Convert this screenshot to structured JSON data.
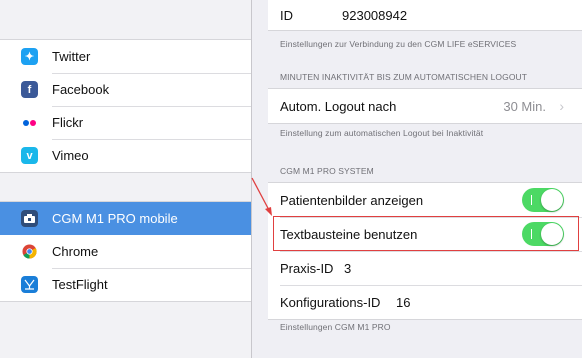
{
  "sidebar": {
    "items": [
      {
        "label": "Twitter",
        "icon": "twitter-icon",
        "color": "#1da1f2",
        "glyph": "t"
      },
      {
        "label": "Facebook",
        "icon": "facebook-icon",
        "color": "#3b5998",
        "glyph": "f"
      },
      {
        "label": "Flickr",
        "icon": "flickr-icon",
        "color": "#ffffff",
        "glyph": ""
      },
      {
        "label": "Vimeo",
        "icon": "vimeo-icon",
        "color": "#1ab7ea",
        "glyph": "v"
      }
    ],
    "apps": [
      {
        "label": "CGM M1 PRO mobile",
        "icon": "cgm-app-icon",
        "selected": true
      },
      {
        "label": "Chrome",
        "icon": "chrome-icon",
        "selected": false
      },
      {
        "label": "TestFlight",
        "icon": "testflight-icon",
        "selected": false
      }
    ]
  },
  "main": {
    "id_row": {
      "label": "ID",
      "value": "923008942"
    },
    "id_caption": "Einstellungen zur Verbindung zu den CGM LIFE eSERVICES",
    "logout_header": "MINUTEN INAKTIVITÄT BIS ZUM AUTOMATISCHEN LOGOUT",
    "logout_row": {
      "label": "Autom. Logout nach",
      "value": "30 Min."
    },
    "logout_caption": "Einstellung zum automatischen Logout bei Inaktivität",
    "system_header": "CGM M1 PRO SYSTEM",
    "system_rows": {
      "patient_images": {
        "label": "Patientenbilder anzeigen",
        "on": true
      },
      "text_blocks": {
        "label": "Textbausteine benutzen",
        "on": true
      },
      "practice": {
        "label": "Praxis-ID",
        "value": "3"
      },
      "config": {
        "label": "Konfigurations-ID",
        "value": "16"
      }
    },
    "system_caption": "Einstellungen CGM M1 PRO"
  },
  "colors": {
    "accent": "#4a90e2",
    "toggle_on": "#4cd964",
    "annotation": "#e04040"
  }
}
